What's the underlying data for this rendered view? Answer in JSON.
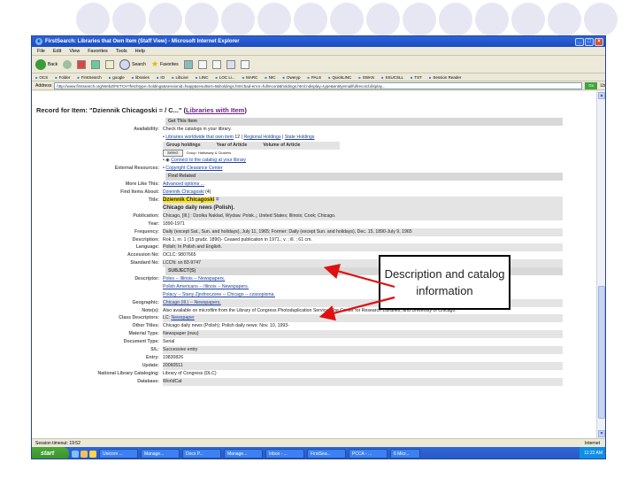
{
  "window": {
    "title": "FirstSearch: Libraries that Own Item (Staff View) - Microsoft Internet Explorer"
  },
  "menu": [
    "File",
    "Edit",
    "View",
    "Favorites",
    "Tools",
    "Help"
  ],
  "toolbar": {
    "back": "Back",
    "search": "Search",
    "favorites": "Favorites"
  },
  "links": [
    "OCS",
    "Folder",
    "FirstSearch",
    "google",
    "libraries",
    "IO",
    "LibLive",
    "LINC",
    "LOC Li...",
    "MARC",
    "NIC",
    "Oweryp",
    "PALS",
    "QuickLINC",
    "SWAN",
    "SSUCSLL",
    "TST",
    "Session Reader"
  ],
  "address": {
    "label": "Address",
    "url": "http://www.firstsearch.org/WebZ/FETCH?fetchtype=holdings&sessionid=fsapp&resultset=6&holdings.html:bad-error=fullrecord&holdings.html:ndisplay=type&entityemailfullrecord:display...",
    "go": "Go",
    "links": "Lb"
  },
  "record": {
    "prefix": "Record for Item:",
    "item": "\"Dziennik Chicagoski = / C...\" (",
    "libraries": "Libraries with Item",
    "suffix": ")"
  },
  "sections": {
    "get_this_item": "Get This Item",
    "find_related": "Find Related",
    "subjects": "SUBJECT(S)"
  },
  "availability": {
    "label": "Availability:",
    "value": "Check the catalogs in your library.",
    "libraries_link": "Libraries worldwide that own item",
    "count": "12",
    "regional": "Regional Holdings",
    "state": "State Holdings",
    "col_group": "Group holdings",
    "col_year": "Year of Article",
    "col_volume": "Volume of Article",
    "select": "Select",
    "group_note": "Group: Hathaway & Clusters",
    "connect": "Connect to the catalog at your library"
  },
  "external": {
    "label": "External Resources:",
    "value": "Copyright Clearance Center"
  },
  "more_like": {
    "label": "More Like This:",
    "value": "Advanced options ..."
  },
  "find_about": {
    "label": "Find Items About:",
    "value": "Dziennik Chicagoski",
    "count": "(4)"
  },
  "title": {
    "label": "Title:",
    "highlight": "Dziennik Chicagoski",
    "rest": " =",
    "line2": "Chicago daily news",
    "line2_rest": " (Polish)."
  },
  "fields": [
    {
      "label": "Publication:",
      "value": "Chicago, [Ill.] : Dzolka Naklad, Wydaw. Polsk.,; United States; Illinois; Cook; Chicago."
    },
    {
      "label": "Year:",
      "value": "1890-1971"
    },
    {
      "label": "Frequency:",
      "value": "Daily (except Sat., Sun. and holidays), July 11, 1965; Former: Daily (except Sun. and holidays), Dec. 15, 1890-July 9, 1965"
    },
    {
      "label": "Description:",
      "value": "Rok 1, nr. 1 (15 grudz. 1890)- Ceased publication in 1971.; v. ; ill. ; 61 cm."
    },
    {
      "label": "Language:",
      "value": "Polish; In Polish and English."
    },
    {
      "label": "Accession No:",
      "value": "OCLC: 9807665"
    },
    {
      "label": "Standard No:",
      "value": "LCCN: sn 83-9747"
    }
  ],
  "descriptor": {
    "label": "Descriptor:",
    "items": [
      "Poles -- Illinois -- Newspapers.",
      "Polish Americans -- Illinois -- Newspapers.",
      "Polacy -- Stany Zjednoczone -- Chicago -- czasopisma."
    ]
  },
  "geographic": {
    "label": "Geographic:",
    "value": "Chicago (Ill.) -- Newspapers."
  },
  "notes": {
    "label": "Note(s):",
    "value": "Also available on microfilm from the Library of Congress Photoduplication Service; The Center for Research Libraries, and University of Chicago."
  },
  "class_desc": {
    "label": "Class Descriptors:",
    "prefix": "LC:",
    "value": "Newspaper"
  },
  "fields2": [
    {
      "label": "Other Titles:",
      "value": "Chicago daily news (Polish); Polish daily news: Nov. 10, 1993-"
    },
    {
      "label": "Material Type:",
      "value": "Newspaper (nwu)"
    },
    {
      "label": "Document Type:",
      "value": "Serial"
    },
    {
      "label": "S/L:",
      "value": "Successive entry"
    },
    {
      "label": "Entry:",
      "value": "19830826"
    },
    {
      "label": "Update:",
      "value": "20060511"
    },
    {
      "label": "National Library Cataloging:",
      "value": "Library of Congress (DLC)"
    },
    {
      "label": "Database:",
      "value": "WorldCat"
    }
  ],
  "callout": {
    "text": "Description and catalog information"
  },
  "status": {
    "left": "Session timeout: 19:52",
    "right": "Internet"
  },
  "taskbar": {
    "start": "start",
    "tasks": [
      "Unicorn ...",
      "Manage...",
      "Docs P...",
      "Manage...",
      "Inbox - ...",
      "FirstSea...",
      "PCCA - ...",
      "6 Micr..."
    ],
    "clock": "11:22 AM"
  }
}
